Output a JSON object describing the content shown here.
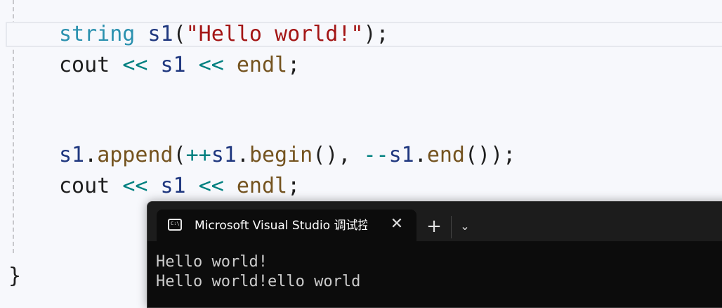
{
  "editor": {
    "line1": {
      "type": "string",
      "var": "s1",
      "paren_open": "(",
      "str": "\"Hello world!\"",
      "paren_close": ");"
    },
    "line2": {
      "ident": "cout",
      "op1": "<<",
      "var": "s1",
      "op2": "<<",
      "fn": "endl",
      "end": ";"
    },
    "line3": {
      "var1": "s1",
      "dot1": ".",
      "fn1": "append",
      "p1": "(",
      "op_inc": "++",
      "var2": "s1",
      "dot2": ".",
      "fn2": "begin",
      "p2": "(),",
      "op_dec": "--",
      "var3": "s1",
      "dot3": ".",
      "fn3": "end",
      "p3": "());"
    },
    "line4": {
      "ident": "cout",
      "op1": "<<",
      "var": "s1",
      "op2": "<<",
      "fn": "endl",
      "end": ";"
    },
    "closing_brace": "}"
  },
  "terminal": {
    "tab_title": "Microsoft Visual Studio 调试控制台",
    "tab_icon": "console-icon",
    "close_glyph": "✕",
    "new_tab_glyph": "+",
    "dropdown_glyph": "⌄",
    "output": [
      "Hello world!",
      "Hello world!ello world"
    ]
  }
}
